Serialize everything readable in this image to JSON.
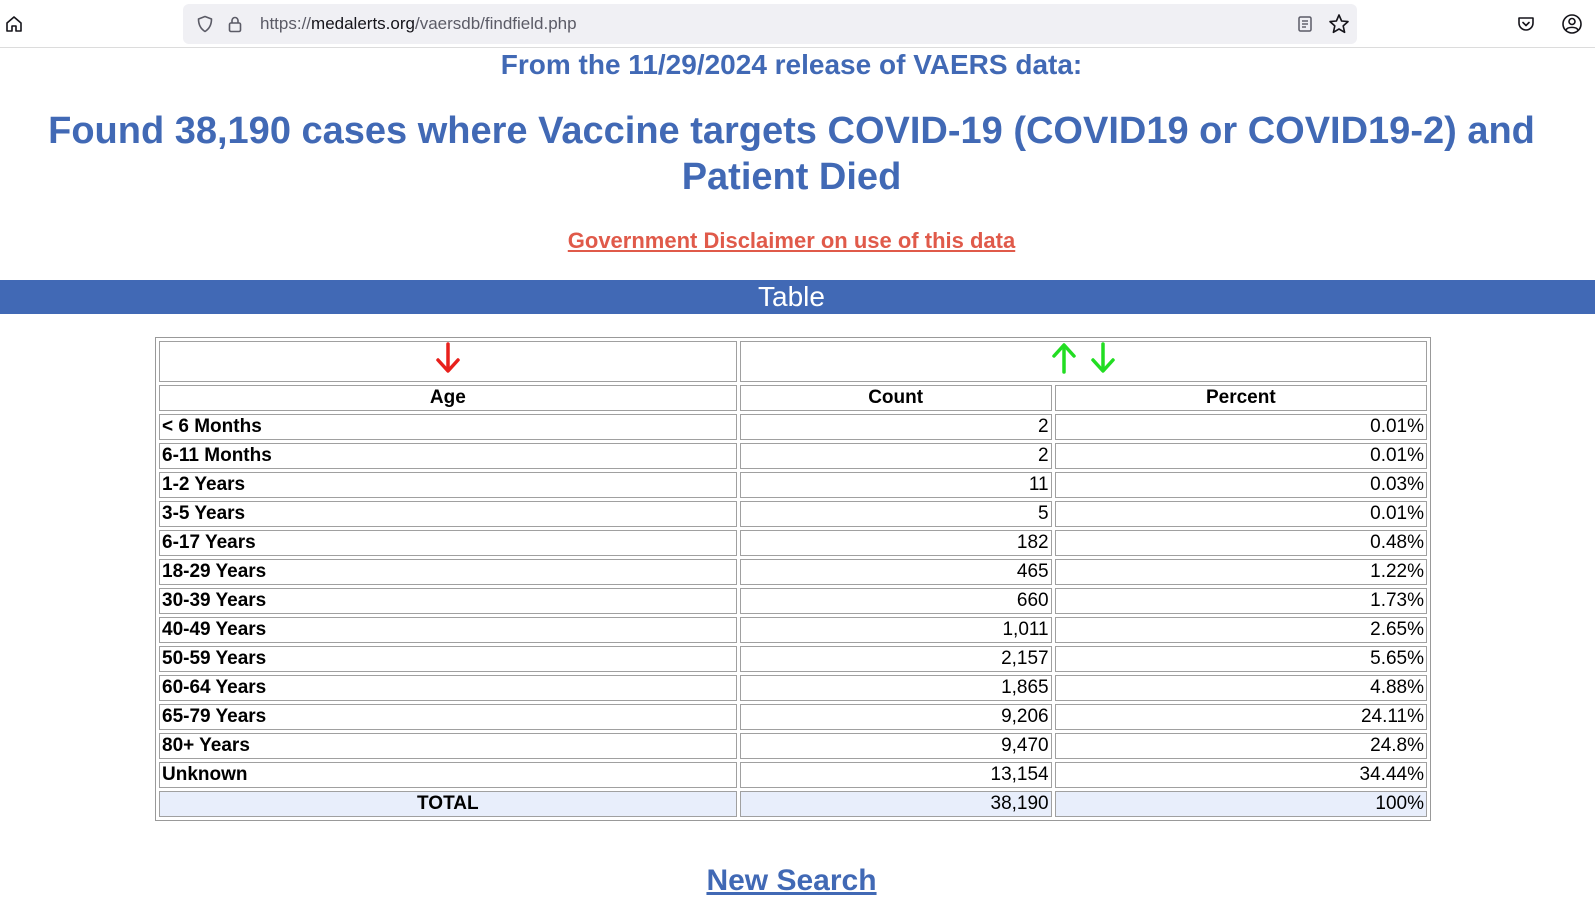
{
  "browser": {
    "url_prefix": "https://",
    "url_domain": "medalerts.org",
    "url_path": "/vaersdb/findfield.php"
  },
  "page": {
    "release_line": "From the 11/29/2024 release of VAERS data:",
    "headline": "Found 38,190 cases where Vaccine targets COVID-19 (COVID19 or COVID19-2) and Patient Died",
    "disclaimer_link": "Government Disclaimer on use of this data",
    "section_title": "Table",
    "new_search_link": "New Search"
  },
  "colors": {
    "title_blue": "#4169b5",
    "disclaimer_red": "#e05a4a",
    "sort_active_red": "#e8201c",
    "sort_inactive_green": "#22dd22",
    "total_row_bg": "#e8eefb"
  },
  "icons": {
    "home": "home-icon",
    "shield": "shield-icon",
    "lock": "lock-icon",
    "reader": "reader-view-icon",
    "star": "bookmark-star-icon",
    "pocket": "pocket-icon",
    "account": "account-icon",
    "sort_age": "sort-down-arrow-icon",
    "sort_count_up": "sort-up-arrow-icon",
    "sort_count_down": "sort-down-arrow-icon"
  },
  "table": {
    "headers": {
      "age": "Age",
      "count": "Count",
      "percent": "Percent"
    },
    "rows": [
      {
        "age": "< 6 Months",
        "count": "2",
        "percent": "0.01%"
      },
      {
        "age": "6-11 Months",
        "count": "2",
        "percent": "0.01%"
      },
      {
        "age": "1-2 Years",
        "count": "11",
        "percent": "0.03%"
      },
      {
        "age": "3-5 Years",
        "count": "5",
        "percent": "0.01%"
      },
      {
        "age": "6-17 Years",
        "count": "182",
        "percent": "0.48%"
      },
      {
        "age": "18-29 Years",
        "count": "465",
        "percent": "1.22%"
      },
      {
        "age": "30-39 Years",
        "count": "660",
        "percent": "1.73%"
      },
      {
        "age": "40-49 Years",
        "count": "1,011",
        "percent": "2.65%"
      },
      {
        "age": "50-59 Years",
        "count": "2,157",
        "percent": "5.65%"
      },
      {
        "age": "60-64 Years",
        "count": "1,865",
        "percent": "4.88%"
      },
      {
        "age": "65-79 Years",
        "count": "9,206",
        "percent": "24.11%"
      },
      {
        "age": "80+ Years",
        "count": "9,470",
        "percent": "24.8%"
      },
      {
        "age": "Unknown",
        "count": "13,154",
        "percent": "34.44%"
      }
    ],
    "total": {
      "age": "TOTAL",
      "count": "38,190",
      "percent": "100%"
    }
  }
}
